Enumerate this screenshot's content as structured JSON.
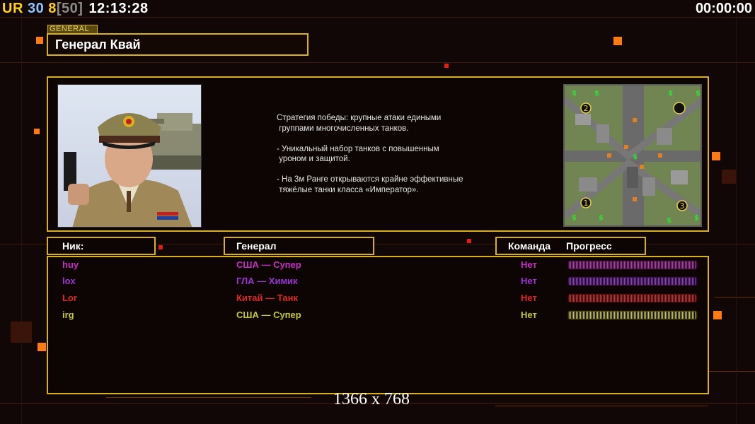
{
  "hud": {
    "ur": "UR",
    "n1": "30",
    "n2": "8",
    "n3": "[50]",
    "clock": "12:13:28",
    "timer": "00:00:00"
  },
  "tag": "GENERAL",
  "general_name": "Генерал Квай",
  "description": "Стратегия победы: крупные атаки едиными\n группами многочисленных танков.\n\n- Уникальный набор танков с повышенным\n уроном и защитой.\n\n- На 3м Ранге открываются крайне эффективные\n тяжёлые танки класса «Император».",
  "minimap": {
    "spots": [
      "1",
      "2",
      "3"
    ]
  },
  "columns": {
    "nick": "Ник:",
    "general": "Генерал",
    "team": "Команда",
    "progress": "Прогресс"
  },
  "players": [
    {
      "nick": "huy",
      "general": "США — Супер",
      "team": "Нет",
      "color": "#c42fc4",
      "progress": 1.0
    },
    {
      "nick": "lox",
      "general": "ГЛА — Химик",
      "team": "Нет",
      "color": "#9a34d6",
      "progress": 1.0
    },
    {
      "nick": "Lor",
      "general": "Китай — Танк",
      "team": "Нет",
      "color": "#e02828",
      "progress": 1.0
    },
    {
      "nick": "irg",
      "general": "США — Супер",
      "team": "Нет",
      "color": "#c8c832",
      "progress": 1.0
    }
  ],
  "resolution": "1366 x 768"
}
